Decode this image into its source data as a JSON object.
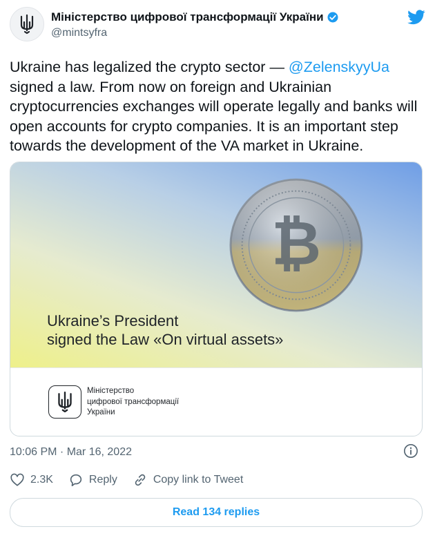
{
  "account": {
    "display_name": "Міністерство цифрової трансформації України",
    "handle": "@mintsyfra",
    "verified": true,
    "avatar_icon": "trident-icon"
  },
  "tweet": {
    "text_before": "Ukraine has legalized the crypto sector — ",
    "mention": "@ZelenskyyUa",
    "text_after": " signed a law. From now on foreign and Ukrainian cryptocurrencies exchanges will operate legally and banks will open accounts for crypto companies. It is an important step towards the development of the VA market in Ukraine.",
    "timestamp": "10:06 PM · Mar 16, 2022"
  },
  "card": {
    "headline_line1": "Ukraine’s President",
    "headline_line2": "signed the Law «On virtual assets»",
    "org_line1": "Міністерство",
    "org_line2": "цифрової трансформації",
    "org_line3": "України",
    "image_icon": "bitcoin-coin-icon"
  },
  "actions": {
    "like_count": "2.3K",
    "reply_label": "Reply",
    "copy_label": "Copy link to Tweet",
    "read_replies_label": "Read 134 replies"
  },
  "colors": {
    "accent": "#1d9bf0",
    "text": "#0f1419",
    "muted": "#536471"
  }
}
